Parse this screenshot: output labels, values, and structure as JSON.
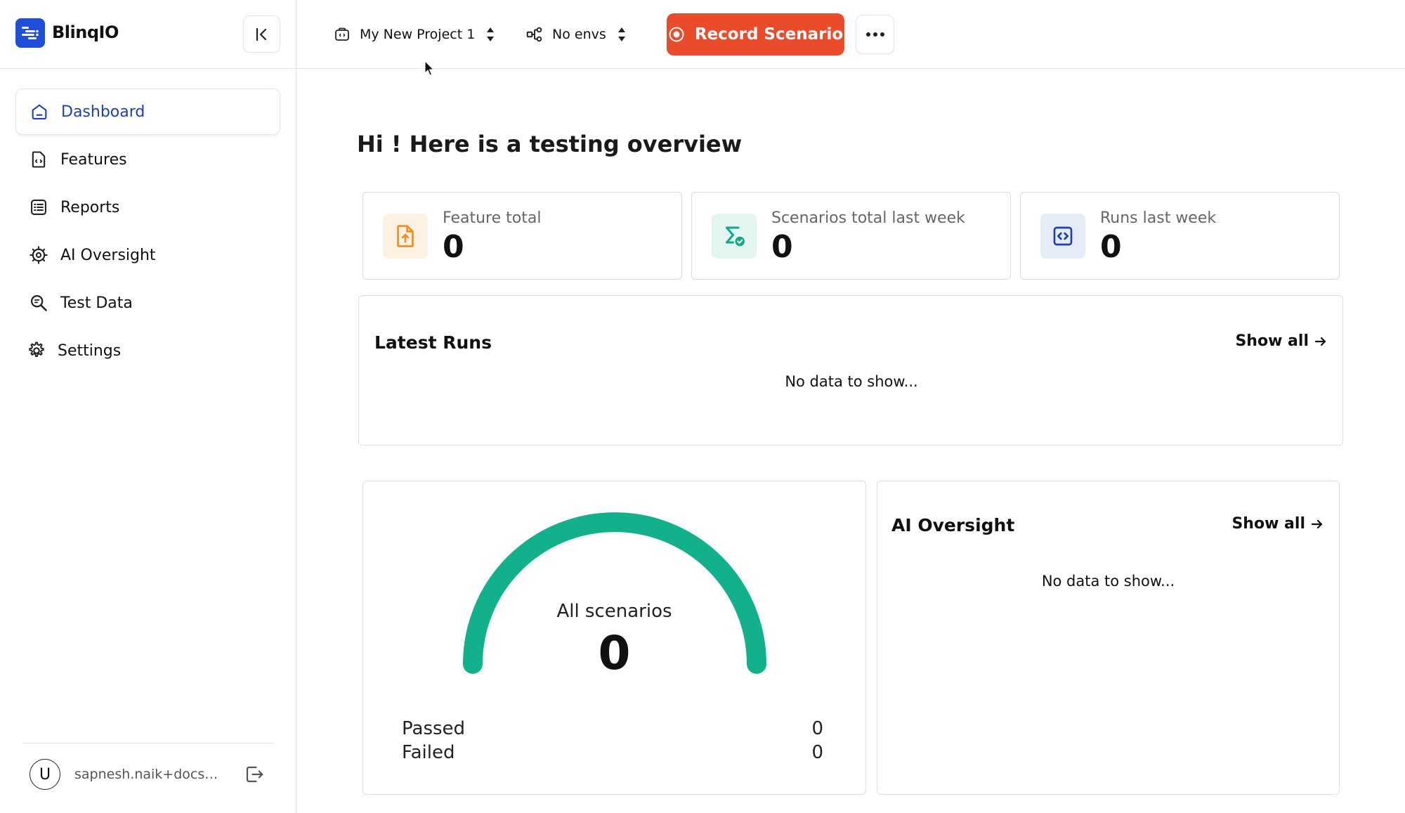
{
  "app": {
    "name": "BlinqIO",
    "brand_color": "#1f4fd8",
    "accent_color": "#ea4b2a"
  },
  "sidebar": {
    "items": [
      {
        "label": "Dashboard",
        "icon": "home-icon",
        "active": true
      },
      {
        "label": "Features",
        "icon": "feature-file-icon"
      },
      {
        "label": "Reports",
        "icon": "list-icon"
      },
      {
        "label": "AI Oversight",
        "icon": "ai-chip-icon"
      },
      {
        "label": "Test Data",
        "icon": "search-data-icon"
      },
      {
        "label": "Settings",
        "icon": "gear-icon"
      }
    ],
    "user": {
      "initial": "U",
      "email": "sapnesh.naik+docs@..."
    }
  },
  "topbar": {
    "project": "My New Project 1",
    "env": "No envs",
    "record_label": "Record Scenario"
  },
  "main": {
    "greeting": "Hi ! Here is a testing overview",
    "stats": [
      {
        "label": "Feature total",
        "value": "0",
        "icon": "file-upload-icon",
        "color": "#f08c1e",
        "bg": "#fdf1e3"
      },
      {
        "label": "Scenarios total last week",
        "value": "0",
        "icon": "scenario-check-icon",
        "color": "#13a887",
        "bg": "#e3f5f0"
      },
      {
        "label": "Runs last week",
        "value": "0",
        "icon": "code-icon",
        "color": "#1f3fb0",
        "bg": "#e6ebf8"
      }
    ],
    "latest_runs": {
      "title": "Latest Runs",
      "show_all": "Show all",
      "empty": "No data to show..."
    },
    "gauge": {
      "label": "All scenarios",
      "value": "0",
      "color": "#13b08c",
      "passed_label": "Passed",
      "passed_value": "0",
      "failed_label": "Failed",
      "failed_value": "0"
    },
    "ai_oversight": {
      "title": "AI Oversight",
      "show_all": "Show all",
      "empty": "No data to show..."
    }
  }
}
